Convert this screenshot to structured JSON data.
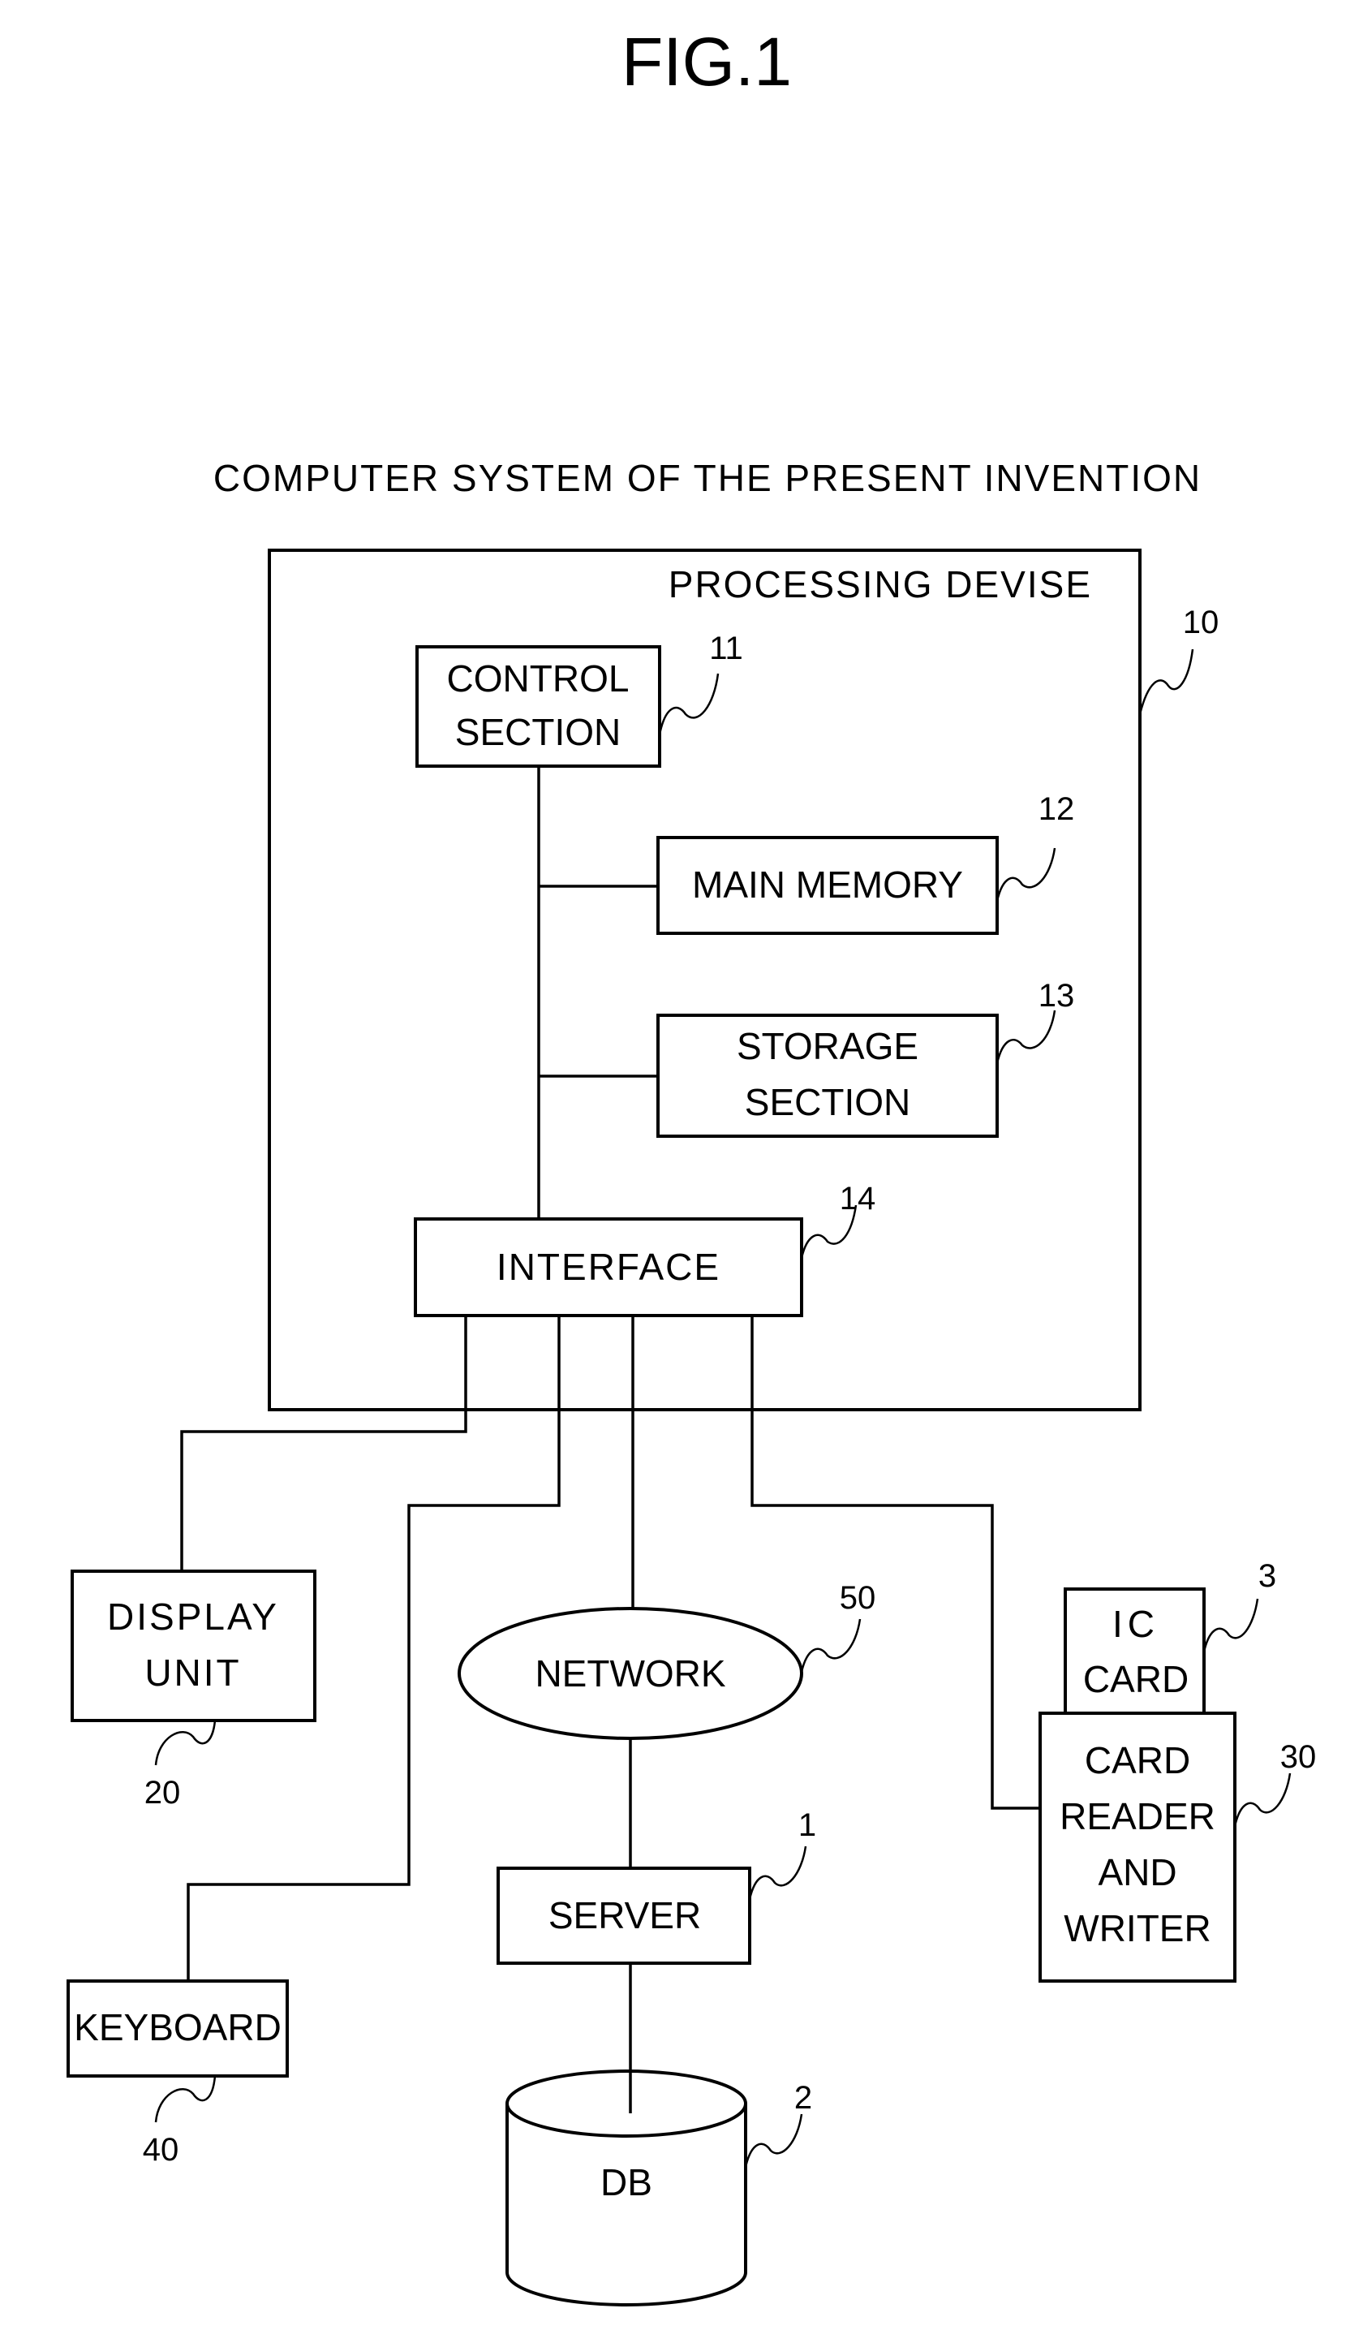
{
  "figure": {
    "title": "FIG.1",
    "subtitle": "COMPUTER SYSTEM OF THE PRESENT INVENTION"
  },
  "processing_device": {
    "label": "PROCESSING DEVISE",
    "ref": "10",
    "control_section": {
      "lines": [
        "CONTROL",
        "SECTION"
      ],
      "ref": "11"
    },
    "main_memory": {
      "label": "MAIN MEMORY",
      "ref": "12"
    },
    "storage_section": {
      "lines": [
        "STORAGE",
        "SECTION"
      ],
      "ref": "13"
    },
    "interface": {
      "label": "INTERFACE",
      "ref": "14"
    }
  },
  "peripherals": {
    "display_unit": {
      "lines": [
        "DISPLAY",
        "UNIT"
      ],
      "ref": "20"
    },
    "keyboard": {
      "label": "KEYBOARD",
      "ref": "40"
    },
    "network": {
      "label": "NETWORK",
      "ref": "50"
    },
    "server": {
      "label": "SERVER",
      "ref": "1"
    },
    "db": {
      "label": "DB",
      "ref": "2"
    },
    "ic_card": {
      "lines": [
        "IC",
        "CARD"
      ],
      "ref": "3"
    },
    "card_reader_writer": {
      "lines": [
        "CARD",
        "READER",
        "AND",
        "WRITER"
      ],
      "ref": "30"
    }
  }
}
